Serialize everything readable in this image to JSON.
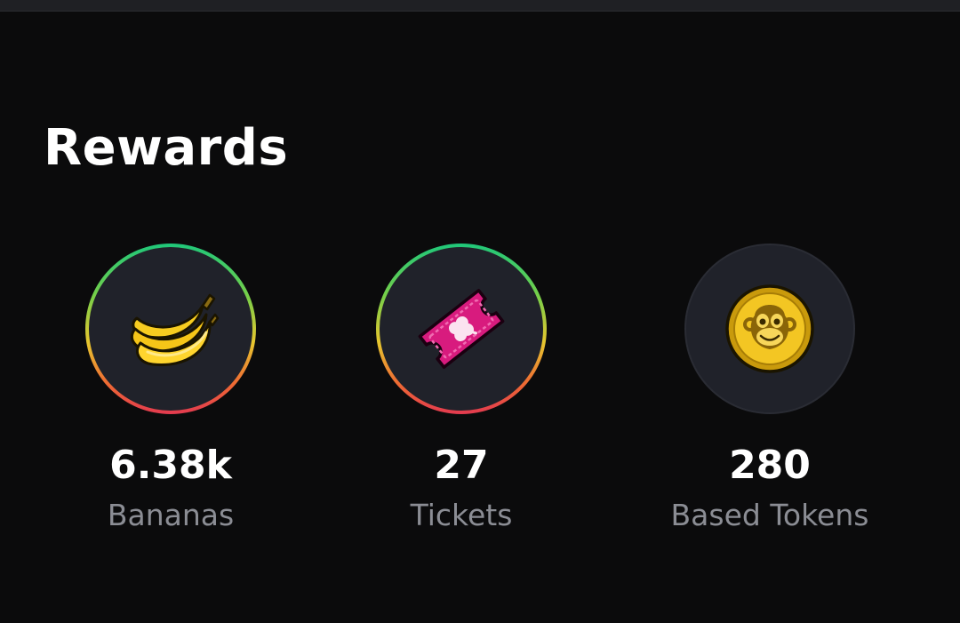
{
  "section": {
    "title": "Rewards"
  },
  "rewards": [
    {
      "value": "6.38k",
      "label": "Bananas",
      "icon": "banana-icon"
    },
    {
      "value": "27",
      "label": "Tickets",
      "icon": "ticket-icon"
    },
    {
      "value": "280",
      "label": "Based Tokens",
      "icon": "token-coin-icon"
    }
  ],
  "colors": {
    "background": "#0b0b0c",
    "card": "#20222a",
    "ring_gradient": [
      "#1fc77a",
      "#e7c72f",
      "#e33a4f"
    ],
    "label": "#8b8d94",
    "ticket": "#d81b7e",
    "coin": "#e6b817"
  }
}
